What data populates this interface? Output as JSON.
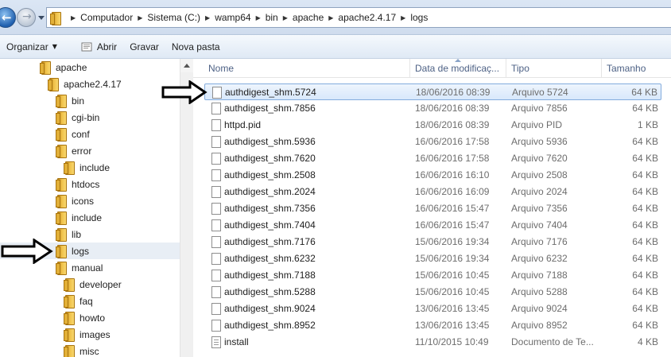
{
  "address_bar": {
    "crumbs": [
      "Computador",
      "Sistema (C:)",
      "wamp64",
      "bin",
      "apache",
      "apache2.4.17",
      "logs"
    ]
  },
  "toolbar": {
    "organize": "Organizar",
    "open": "Abrir",
    "burn": "Gravar",
    "new_folder": "Nova pasta"
  },
  "tree": [
    {
      "label": "apache",
      "level": 1
    },
    {
      "label": "apache2.4.17",
      "level": 2
    },
    {
      "label": "bin",
      "level": 3
    },
    {
      "label": "cgi-bin",
      "level": 3
    },
    {
      "label": "conf",
      "level": 3
    },
    {
      "label": "error",
      "level": 3
    },
    {
      "label": "include",
      "level": 4
    },
    {
      "label": "htdocs",
      "level": 3
    },
    {
      "label": "icons",
      "level": 3
    },
    {
      "label": "include",
      "level": 3
    },
    {
      "label": "lib",
      "level": 3
    },
    {
      "label": "logs",
      "level": 3,
      "selected": true
    },
    {
      "label": "manual",
      "level": 3
    },
    {
      "label": "developer",
      "level": 4
    },
    {
      "label": "faq",
      "level": 4
    },
    {
      "label": "howto",
      "level": 4
    },
    {
      "label": "images",
      "level": 4
    },
    {
      "label": "misc",
      "level": 4
    }
  ],
  "columns": {
    "name": "Nome",
    "date": "Data de modificaç...",
    "type": "Tipo",
    "size": "Tamanho"
  },
  "files": [
    {
      "name": "authdigest_shm.5724",
      "date": "18/06/2016 08:39",
      "type": "Arquivo 5724",
      "size": "64 KB",
      "selected": true
    },
    {
      "name": "authdigest_shm.7856",
      "date": "18/06/2016 08:39",
      "type": "Arquivo 7856",
      "size": "64 KB"
    },
    {
      "name": "httpd.pid",
      "date": "18/06/2016 08:39",
      "type": "Arquivo PID",
      "size": "1 KB"
    },
    {
      "name": "authdigest_shm.5936",
      "date": "16/06/2016 17:58",
      "type": "Arquivo 5936",
      "size": "64 KB"
    },
    {
      "name": "authdigest_shm.7620",
      "date": "16/06/2016 17:58",
      "type": "Arquivo 7620",
      "size": "64 KB"
    },
    {
      "name": "authdigest_shm.2508",
      "date": "16/06/2016 16:10",
      "type": "Arquivo 2508",
      "size": "64 KB"
    },
    {
      "name": "authdigest_shm.2024",
      "date": "16/06/2016 16:09",
      "type": "Arquivo 2024",
      "size": "64 KB"
    },
    {
      "name": "authdigest_shm.7356",
      "date": "16/06/2016 15:47",
      "type": "Arquivo 7356",
      "size": "64 KB"
    },
    {
      "name": "authdigest_shm.7404",
      "date": "16/06/2016 15:47",
      "type": "Arquivo 7404",
      "size": "64 KB"
    },
    {
      "name": "authdigest_shm.7176",
      "date": "15/06/2016 19:34",
      "type": "Arquivo 7176",
      "size": "64 KB"
    },
    {
      "name": "authdigest_shm.6232",
      "date": "15/06/2016 19:34",
      "type": "Arquivo 6232",
      "size": "64 KB"
    },
    {
      "name": "authdigest_shm.7188",
      "date": "15/06/2016 10:45",
      "type": "Arquivo 7188",
      "size": "64 KB"
    },
    {
      "name": "authdigest_shm.5288",
      "date": "15/06/2016 10:45",
      "type": "Arquivo 5288",
      "size": "64 KB"
    },
    {
      "name": "authdigest_shm.9024",
      "date": "13/06/2016 13:45",
      "type": "Arquivo 9024",
      "size": "64 KB"
    },
    {
      "name": "authdigest_shm.8952",
      "date": "13/06/2016 13:45",
      "type": "Arquivo 8952",
      "size": "64 KB"
    },
    {
      "name": "install",
      "date": "11/10/2015 10:49",
      "type": "Documento de Te...",
      "size": "4 KB",
      "icon": "text-file-icon"
    }
  ],
  "colors": {
    "selection_border": "#84acdd",
    "header_text": "#4d6185",
    "folder": "#f0c24b"
  }
}
